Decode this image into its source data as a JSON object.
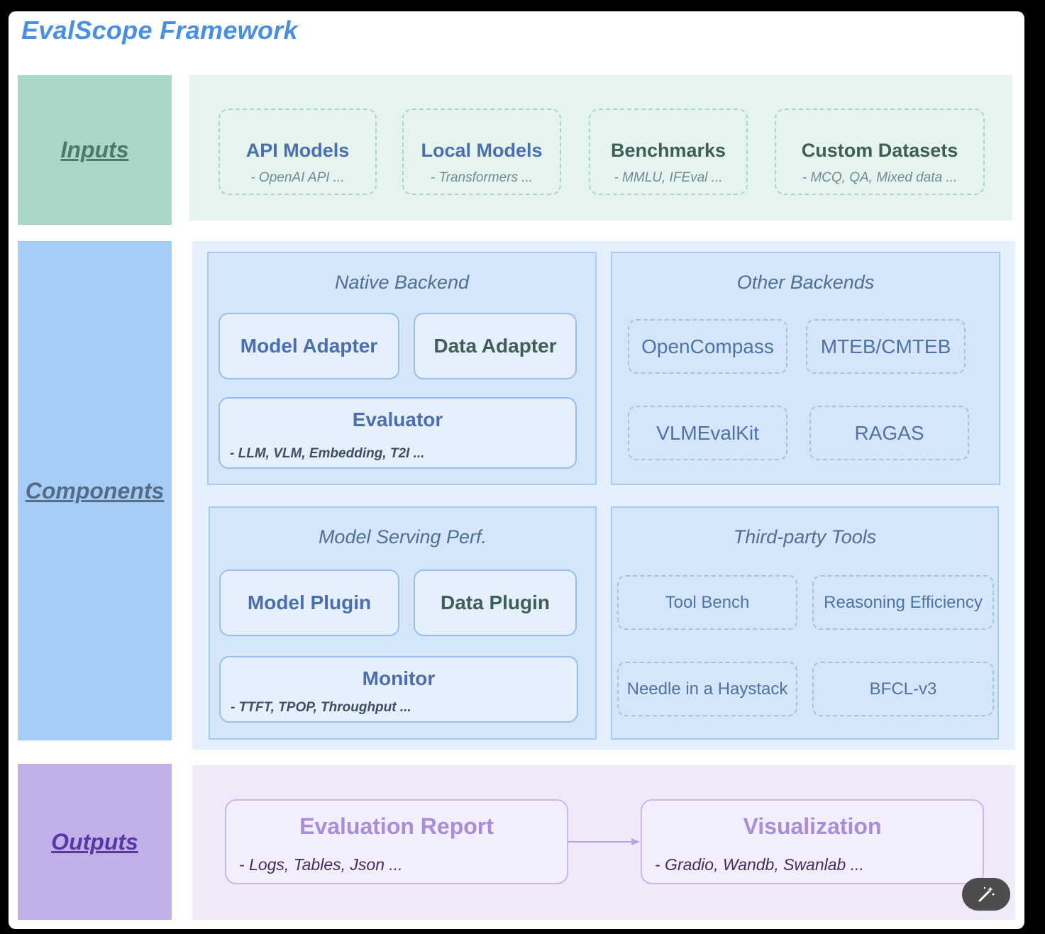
{
  "title": "EvalScope Framework",
  "sections": {
    "inputs": "Inputs",
    "components": "Components",
    "outputs": "Outputs"
  },
  "inputs": [
    {
      "title": "API Models",
      "subtitle": "- OpenAI API ...",
      "color": "#4b6fad"
    },
    {
      "title": "Local Models",
      "subtitle": "- Transformers ...",
      "color": "#4b6fad"
    },
    {
      "title": "Benchmarks",
      "subtitle": "- MMLU, IFEval ...",
      "color": "#3e5e57"
    },
    {
      "title": "Custom Datasets",
      "subtitle": "- MCQ, QA, Mixed data ...",
      "color": "#3e5e57"
    }
  ],
  "native_backend": {
    "title": "Native Backend",
    "model_adapter": "Model Adapter",
    "data_adapter": "Data Adapter",
    "evaluator": {
      "title": "Evaluator",
      "subtitle": "- LLM, VLM, Embedding, T2I ..."
    }
  },
  "other_backends": {
    "title": "Other Backends",
    "items": [
      "OpenCompass",
      "MTEB/CMTEB",
      "VLMEvalKit",
      "RAGAS"
    ]
  },
  "model_serving": {
    "title": "Model  Serving Perf.",
    "model_plugin": "Model Plugin",
    "data_plugin": "Data Plugin",
    "monitor": {
      "title": "Monitor",
      "subtitle": "- TTFT, TPOP, Throughput ..."
    }
  },
  "third_party": {
    "title": "Third-party Tools",
    "items": [
      "Tool Bench",
      "Reasoning Efficiency",
      "Needle in a Haystack",
      "BFCL-v3"
    ]
  },
  "outputs": [
    {
      "title": "Evaluation Report",
      "subtitle": "- Logs, Tables, Json ..."
    },
    {
      "title": "Visualization",
      "subtitle": "- Gradio, Wandb, Swanlab ..."
    }
  ],
  "icons": {
    "magic": "magic-wand-icon"
  }
}
